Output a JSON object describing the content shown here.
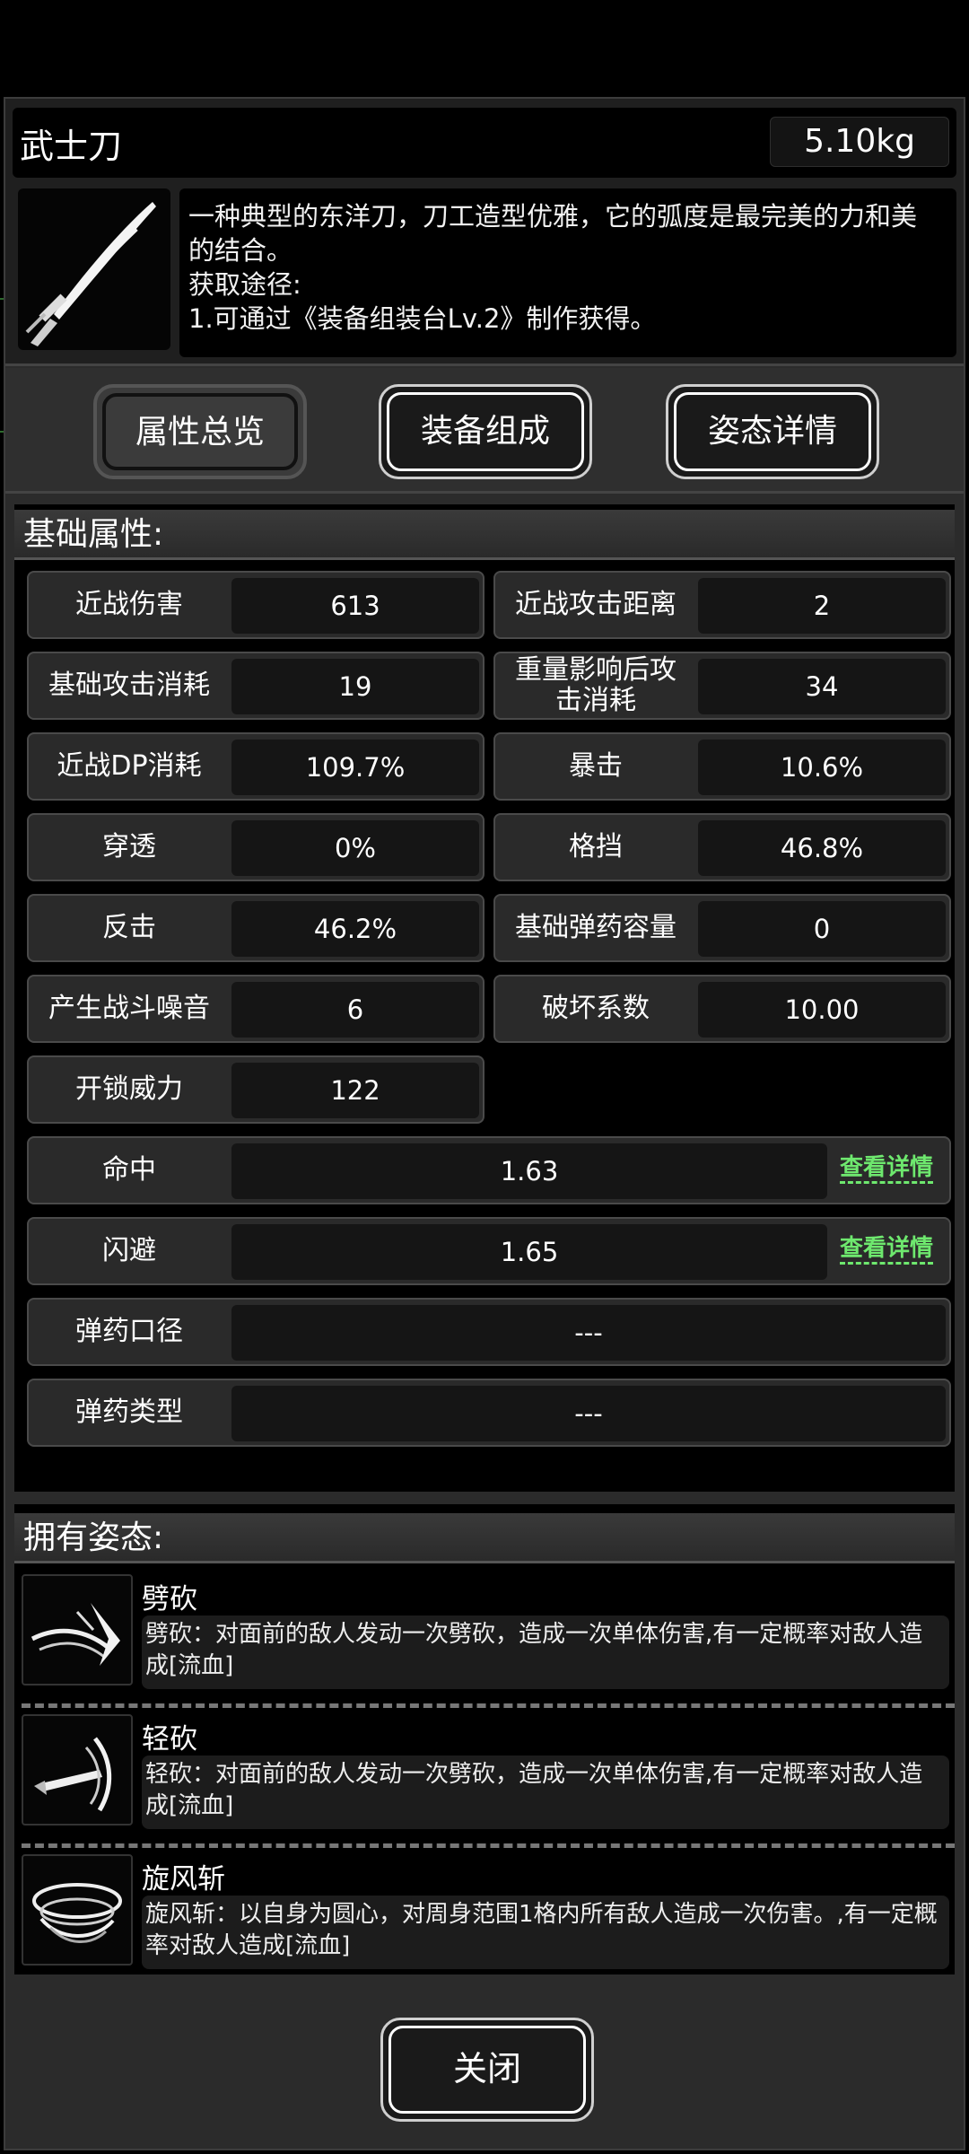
{
  "item": {
    "name": "武士刀",
    "weight": "5.10kg",
    "description_lines": [
      "一种典型的东洋刀，刀工造型优雅，它的弧度是最完美的力和美",
      "的结合。",
      "获取途径:",
      "1.可通过《装备组装台Lv.2》制作获得。"
    ],
    "icon": "katana-icon"
  },
  "tabs": [
    {
      "label": "属性总览",
      "active": true
    },
    {
      "label": "装备组成",
      "active": false
    },
    {
      "label": "姿态详情",
      "active": false
    }
  ],
  "attributes": {
    "title": "基础属性:",
    "pairs": [
      {
        "label": "近战伤害",
        "value": "613"
      },
      {
        "label": "近战攻击距离",
        "value": "2"
      },
      {
        "label": "基础攻击消耗",
        "value": "19"
      },
      {
        "label": "重量影响后攻击消耗",
        "value": "34"
      },
      {
        "label": "近战DP消耗",
        "value": "109.7%"
      },
      {
        "label": "暴击",
        "value": "10.6%"
      },
      {
        "label": "穿透",
        "value": "0%"
      },
      {
        "label": "格挡",
        "value": "46.8%"
      },
      {
        "label": "反击",
        "value": "46.2%"
      },
      {
        "label": "基础弹药容量",
        "value": "0"
      },
      {
        "label": "产生战斗噪音",
        "value": "6"
      },
      {
        "label": "破坏系数",
        "value": "10.00"
      },
      {
        "label": "开锁威力",
        "value": "122"
      }
    ],
    "wide": [
      {
        "label": "命中",
        "value": "1.63",
        "link": "查看详情"
      },
      {
        "label": "闪避",
        "value": "1.65",
        "link": "查看详情"
      },
      {
        "label": "弹药口径",
        "value": "---"
      },
      {
        "label": "弹药类型",
        "value": "---"
      }
    ]
  },
  "stances": {
    "title": "拥有姿态:",
    "items": [
      {
        "name": "劈砍",
        "desc": "劈砍：对面前的敌人发动一次劈砍，造成一次单体伤害,有一定概率对敌人造成[流血]",
        "icon": "slash-icon"
      },
      {
        "name": "轻砍",
        "desc": "轻砍：对面前的敌人发动一次劈砍，造成一次单体伤害,有一定概率对敌人造成[流血]",
        "icon": "light-slash-icon"
      },
      {
        "name": "旋风斩",
        "desc": "旋风斩：以自身为圆心，对周身范围1格内所有敌人造成一次伤害。,有一定概率对敌人造成[流血]",
        "icon": "whirlwind-icon"
      }
    ]
  },
  "close_label": "关闭"
}
